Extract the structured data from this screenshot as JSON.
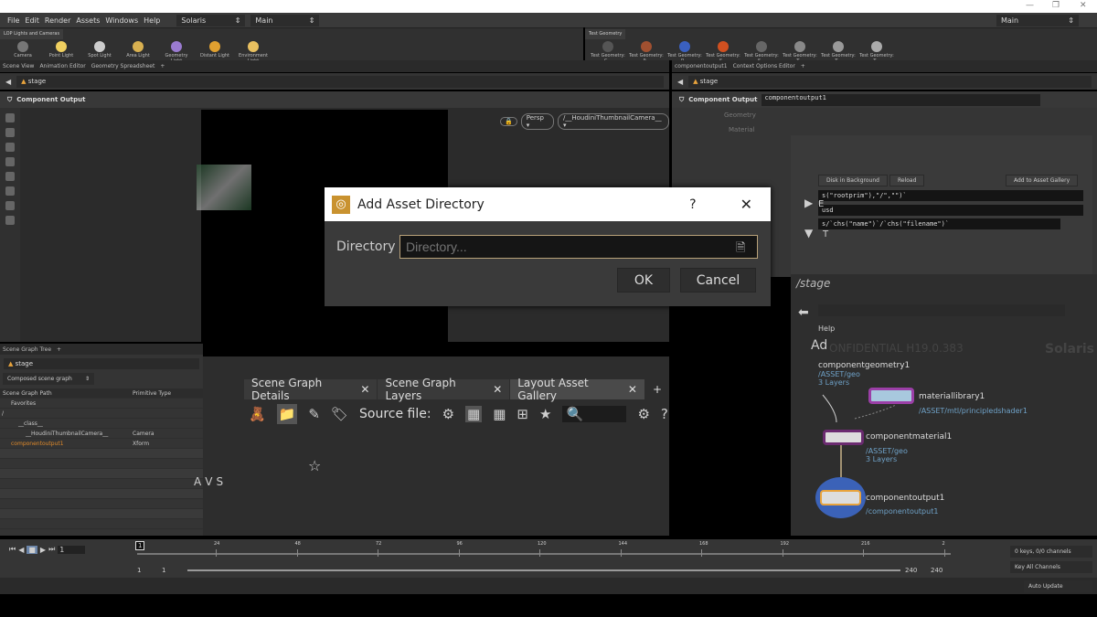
{
  "window": {
    "minimize": "—",
    "maximize": "❐",
    "close": "✕"
  },
  "menu": [
    "File",
    "Edit",
    "Render",
    "Assets",
    "Windows",
    "Help"
  ],
  "desktop": "Solaris",
  "context": "Main",
  "right_desktop": "Main",
  "shelf_left": {
    "tab": "LOP Lights and Cameras",
    "tools": [
      "Camera",
      "Point Light",
      "Spot Light",
      "Area Light",
      "Geometry Light",
      "Distant Light",
      "Environment Light"
    ]
  },
  "shelf_right": {
    "tab": "Test Geometry",
    "tools": [
      "Test Geometry: C...",
      "Test Geometry: P...",
      "Test Geometry: R...",
      "Test Geometry: S...",
      "Test Geometry: S...",
      "Test Geometry: T...",
      "Test Geometry: T...",
      "Test Geometry: T..."
    ]
  },
  "left_panes": [
    "Scene View",
    "Animation Editor",
    "Geometry Spreadsheet"
  ],
  "right_panes": [
    "componentoutput1",
    "Context Options Editor"
  ],
  "path": "stage",
  "viewer_header": "Component Output",
  "viewport": {
    "persp": "Persp ▾",
    "camera": "/__HoudiniThumbnailCamera__ ▾"
  },
  "params": {
    "node_type": "Component Output",
    "node_name": "componentoutput1",
    "labels": [
      "Geometry",
      "Material"
    ],
    "buttons": [
      "Disk in Background",
      "Reload",
      "Add to Asset Gallery"
    ],
    "code1": "s(\"rootprim\"),\"/\",\"\")`",
    "code2": "usd",
    "code3": "s/`chs(\"name\")`/`chs(\"filename\")`",
    "letters": [
      "E",
      "T"
    ]
  },
  "scene_graph": {
    "tab": "Scene Graph Tree",
    "mode": "Composed scene graph",
    "columns": [
      "Scene Graph Path",
      "Primitive Type"
    ],
    "rows": [
      {
        "path": "Favorites",
        "type": ""
      },
      {
        "path": "/",
        "type": ""
      },
      {
        "path": "__class__",
        "type": ""
      },
      {
        "path": "__HoudiniThumbnailCamera__",
        "type": "Camera"
      },
      {
        "path": "componentoutput1",
        "type": "Xform"
      }
    ]
  },
  "details": {
    "tabs": [
      "Scene Graph Details",
      "Scene Graph Layers",
      "Layout Asset Gallery"
    ],
    "source_label": "Source file:",
    "side_letters": [
      "A",
      "V",
      "S"
    ]
  },
  "network": {
    "path": "/stage",
    "help": "Help",
    "watermark": "ONFIDENTIAL H19.0.383",
    "context": "Solaris",
    "partial": "Ad",
    "nodes": [
      {
        "name": "componentgeometry1",
        "sub": [
          "/ASSET/geo",
          "3 Layers"
        ]
      },
      {
        "name": "materiallibrary1",
        "sub": [
          "/ASSET/mtl/principledshader1"
        ]
      },
      {
        "name": "componentmaterial1",
        "sub": [
          "/ASSET/geo",
          "3 Layers"
        ]
      },
      {
        "name": "componentoutput1",
        "sub": [
          "/componentoutput1"
        ]
      }
    ]
  },
  "timeline": {
    "frame": "1",
    "ticks": [
      "24",
      "48",
      "72",
      "96",
      "120",
      "144",
      "168",
      "192",
      "216",
      "2"
    ],
    "start": "1",
    "start2": "1",
    "end": "240",
    "end2": "240",
    "keys": "0 keys, 0/0 channels",
    "key_all": "Key All Channels",
    "auto_update": "Auto Update",
    "marker": "1"
  },
  "dialog": {
    "title": "Add Asset Directory",
    "help": "?",
    "close": "✕",
    "label": "Directory",
    "placeholder": "Directory...",
    "ok": "OK",
    "cancel": "Cancel"
  },
  "colors": {
    "accent": "#e8a33c",
    "node_purple": "#9b3fa7",
    "path_blue": "#6fa2c8",
    "selected": "#e08a2a"
  }
}
